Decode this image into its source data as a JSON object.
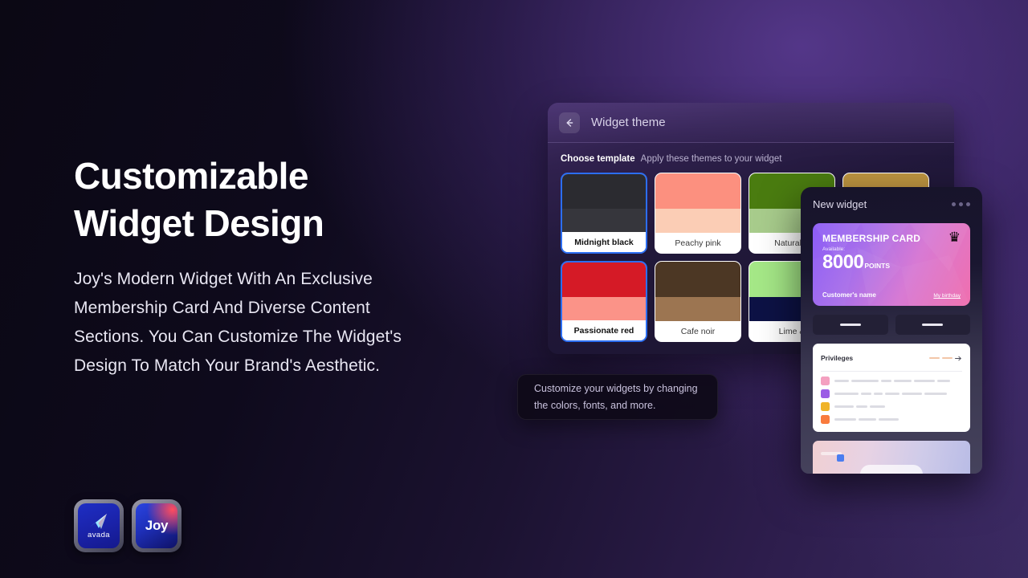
{
  "hero": {
    "headline": "Customizable\nWidget Design",
    "subcopy": "Joy's Modern Widget With An Exclusive\nMembership Card And Diverse Content\nSections. You Can Customize The Widget's\nDesign To Match Your Brand's Aesthetic."
  },
  "logos": [
    {
      "name": "avada",
      "label": "avada",
      "icon": "avada-dart-icon"
    },
    {
      "name": "joy",
      "label": "Joy",
      "icon": "joy-wordmark-icon"
    }
  ],
  "theme_panel": {
    "back_icon": "arrow-left-icon",
    "title": "Widget theme",
    "choose_label": "Choose template",
    "choose_sub": "Apply these themes to your widget",
    "templates": [
      {
        "label": "Midnight black",
        "color_top": "#2b2b30",
        "color_bottom": "#36363c",
        "selected": true
      },
      {
        "label": "Peachy pink",
        "color_top": "#fc907f",
        "color_bottom": "#fbcdb5",
        "selected": false
      },
      {
        "label": "Natural &",
        "color_top": "#4a7c10",
        "color_bottom": "#a8cc8c",
        "selected": false
      },
      {
        "label": "",
        "color_top": "#bd9440",
        "color_bottom": "#bd9440",
        "selected": false
      },
      {
        "label": "Passionate red",
        "color_top": "#d51a26",
        "color_bottom": "#fb9388",
        "selected": true
      },
      {
        "label": "Cafe noir",
        "color_top": "#4c3724",
        "color_bottom": "#9c7551",
        "selected": false
      },
      {
        "label": "Lime &",
        "color_top": "#a5e887",
        "color_bottom": "#0d1245",
        "selected": false
      }
    ]
  },
  "tooltip": {
    "text": "Customize your widgets by changing\nthe colors, fonts, and more."
  },
  "widget": {
    "title": "New widget",
    "menu_icon": "more-dots-icon",
    "card": {
      "title": "MEMBERSHIP CARD",
      "crown_icon": "crown-icon",
      "available_label": "Available:",
      "points_value": "8000",
      "points_unit": "POINTS",
      "customer_name": "Customer's name",
      "birthday_link": "My birthday"
    },
    "privileges": {
      "title": "Privileges",
      "more_icon": "arrow-right-icon",
      "rows": [
        {
          "icon": "gift-cart-icon",
          "icon_color": "#f4a0c0",
          "bars": [
            18,
            34,
            13,
            22,
            26,
            16
          ]
        },
        {
          "icon": "badge-icon",
          "icon_color": "#9b5de5",
          "bars": [
            30,
            13,
            11,
            18,
            25,
            28
          ]
        },
        {
          "icon": "medal-icon",
          "icon_color": "#f0b429",
          "bars": [
            24,
            14,
            19
          ]
        },
        {
          "icon": "gift-box-icon",
          "icon_color": "#f97b3d",
          "bars": [
            27,
            22,
            25
          ]
        }
      ]
    }
  }
}
